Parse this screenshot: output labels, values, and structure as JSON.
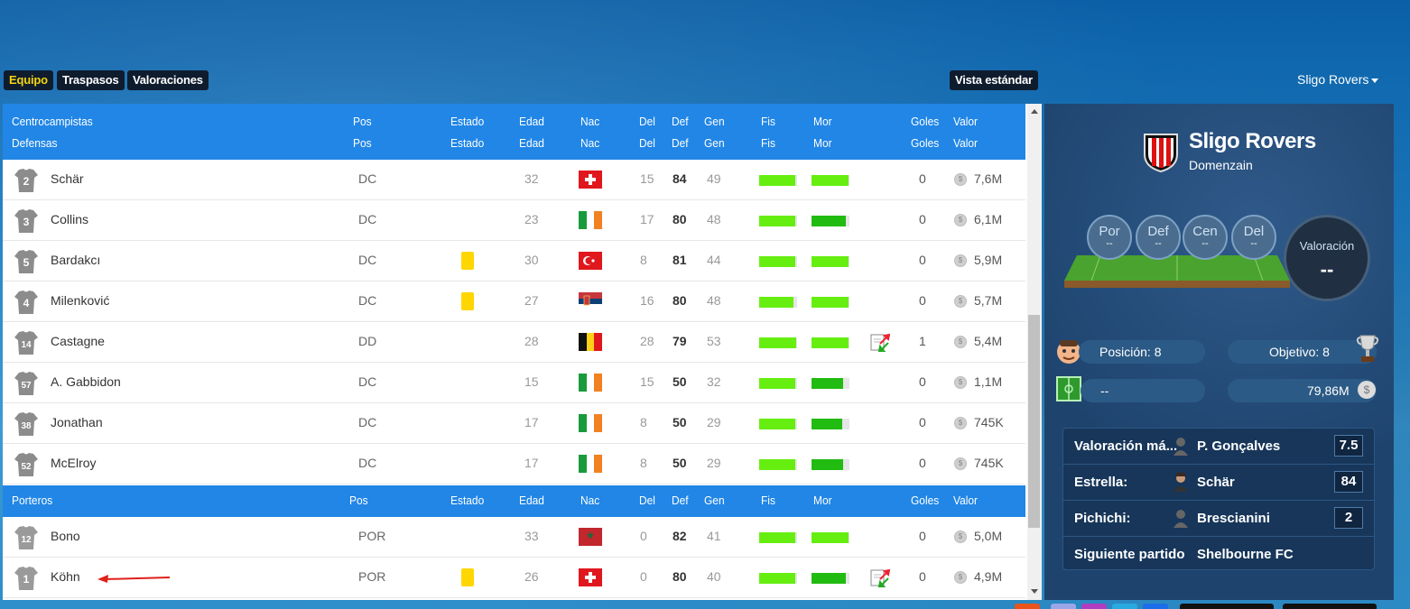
{
  "tabs": [
    {
      "label": "Equipo",
      "active": true
    },
    {
      "label": "Traspasos",
      "active": false
    },
    {
      "label": "Valoraciones",
      "active": false
    }
  ],
  "view_button": "Vista estándar",
  "team_selector": "Sligo Rovers",
  "header_labels": {
    "pos": "Pos",
    "estado": "Estado",
    "edad": "Edad",
    "nac": "Nac",
    "del": "Del",
    "def": "Def",
    "gen": "Gen",
    "fis": "Fis",
    "mor": "Mor",
    "goles": "Goles",
    "valor": "Valor"
  },
  "groups": {
    "centro": "Centrocampistas",
    "defensas": "Defensas",
    "porteros": "Porteros"
  },
  "defenders": [
    {
      "num": "2",
      "name": "Schär",
      "pos": "DC",
      "card": false,
      "age": "32",
      "flag": "switzerland",
      "del": "15",
      "def": "84",
      "gen": "49",
      "fis": 0.95,
      "mor": 0.97,
      "goals": "0",
      "value": "7,6M",
      "transfer": false
    },
    {
      "num": "3",
      "name": "Collins",
      "pos": "DC",
      "card": false,
      "age": "23",
      "flag": "ireland",
      "del": "17",
      "def": "80",
      "gen": "48",
      "fis": 0.95,
      "mor": 0.9,
      "goals": "0",
      "value": "6,1M",
      "transfer": false
    },
    {
      "num": "5",
      "name": "Bardakcı",
      "pos": "DC",
      "card": true,
      "age": "30",
      "flag": "turkey",
      "del": "8",
      "def": "81",
      "gen": "44",
      "fis": 0.95,
      "mor": 0.97,
      "goals": "0",
      "value": "5,9M",
      "transfer": false
    },
    {
      "num": "4",
      "name": "Milenković",
      "pos": "DC",
      "card": true,
      "age": "27",
      "flag": "serbia",
      "del": "16",
      "def": "80",
      "gen": "48",
      "fis": 0.9,
      "mor": 0.97,
      "goals": "0",
      "value": "5,7M",
      "transfer": false
    },
    {
      "num": "14",
      "name": "Castagne",
      "pos": "DD",
      "card": false,
      "age": "28",
      "flag": "belgium",
      "del": "28",
      "def": "79",
      "gen": "53",
      "fis": 0.97,
      "mor": 0.97,
      "goals": "1",
      "value": "5,4M",
      "transfer": true
    },
    {
      "num": "57",
      "name": "A. Gabbidon",
      "pos": "DC",
      "card": false,
      "age": "15",
      "flag": "ireland",
      "del": "15",
      "def": "50",
      "gen": "32",
      "fis": 0.95,
      "mor": 0.83,
      "goals": "0",
      "value": "1,1M",
      "transfer": false
    },
    {
      "num": "38",
      "name": "Jonathan",
      "pos": "DC",
      "card": false,
      "age": "17",
      "flag": "ireland",
      "del": "8",
      "def": "50",
      "gen": "29",
      "fis": 0.95,
      "mor": 0.8,
      "goals": "0",
      "value": "745K",
      "transfer": false
    },
    {
      "num": "52",
      "name": "McElroy",
      "pos": "DC",
      "card": false,
      "age": "17",
      "flag": "ireland",
      "del": "8",
      "def": "50",
      "gen": "29",
      "fis": 0.95,
      "mor": 0.83,
      "goals": "0",
      "value": "745K",
      "transfer": false
    }
  ],
  "goalkeepers": [
    {
      "num": "12",
      "name": "Bono",
      "pos": "POR",
      "card": false,
      "age": "33",
      "flag": "morocco",
      "del": "0",
      "def": "82",
      "gen": "41",
      "fis": 0.95,
      "mor": 0.97,
      "goals": "0",
      "value": "5,0M",
      "transfer": false
    },
    {
      "num": "1",
      "name": "Köhn",
      "pos": "POR",
      "card": true,
      "age": "26",
      "flag": "switzerland",
      "del": "0",
      "def": "80",
      "gen": "40",
      "fis": 0.95,
      "mor": 0.9,
      "goals": "0",
      "value": "4,9M",
      "transfer": true
    }
  ],
  "club": {
    "name": "Sligo Rovers",
    "manager": "Domenzain",
    "lines": [
      {
        "label": "Por",
        "value": "--"
      },
      {
        "label": "Def",
        "value": "--"
      },
      {
        "label": "Cen",
        "value": "--"
      },
      {
        "label": "Del",
        "value": "--"
      }
    ],
    "rating_label": "Valoración",
    "rating_value": "--",
    "position": "Posición: 8",
    "objective": "Objetivo: 8",
    "formation": "--",
    "budget": "79,86M",
    "info": [
      {
        "label": "Valoración má...",
        "player": "P. Gonçalves",
        "value": "7.5",
        "avatar": "silhouette"
      },
      {
        "label": "Estrella:",
        "player": "Schär",
        "value": "84",
        "avatar": "photo"
      },
      {
        "label": "Pichichi:",
        "player": "Brescianini",
        "value": "2",
        "avatar": "silhouette"
      },
      {
        "label": "Siguiente partido",
        "player": "Shelbourne FC",
        "value": "",
        "avatar": "none"
      }
    ]
  },
  "colors": {
    "header_blue": "#2186e6",
    "tab_active": "#f5d30f",
    "bar_green": "#66ee11",
    "bar_dark_green": "#22bb11",
    "card_yellow": "#ffd600",
    "side_panel": "#1e446e"
  }
}
